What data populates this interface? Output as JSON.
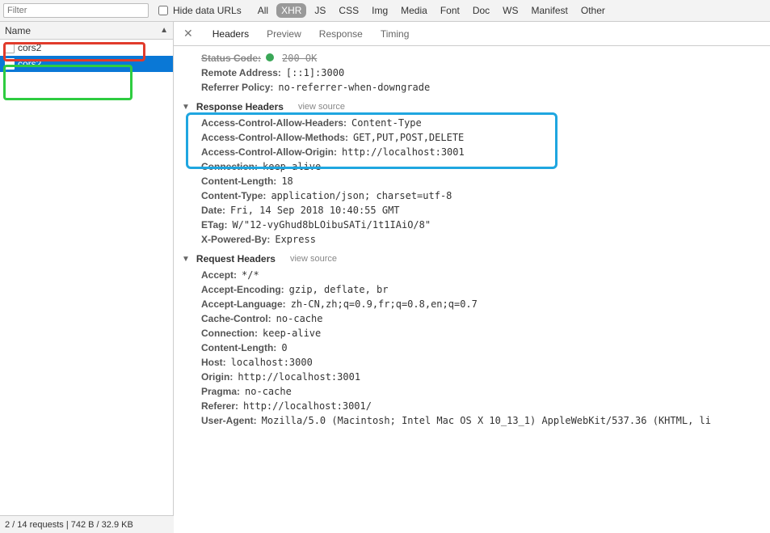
{
  "toolbar": {
    "filter_placeholder": "Filter",
    "hide_data_urls": "Hide data URLs",
    "types": [
      "All",
      "XHR",
      "JS",
      "CSS",
      "Img",
      "Media",
      "Font",
      "Doc",
      "WS",
      "Manifest",
      "Other"
    ],
    "active_type": "XHR"
  },
  "left": {
    "header": "Name",
    "items": [
      "cors2",
      "cors2"
    ],
    "selected_index": 1
  },
  "detail_tabs": {
    "items": [
      "Headers",
      "Preview",
      "Response",
      "Timing"
    ],
    "active": "Headers"
  },
  "general": {
    "status_code_label": "Status Code:",
    "status_code_value": "200 OK",
    "remote_address_label": "Remote Address:",
    "remote_address_value": "[::1]:3000",
    "referrer_policy_label": "Referrer Policy:",
    "referrer_policy_value": "no-referrer-when-downgrade"
  },
  "response_headers": {
    "title": "Response Headers",
    "view_source": "view source",
    "rows": [
      {
        "k": "Access-Control-Allow-Headers:",
        "v": "Content-Type"
      },
      {
        "k": "Access-Control-Allow-Methods:",
        "v": "GET,PUT,POST,DELETE"
      },
      {
        "k": "Access-Control-Allow-Origin:",
        "v": "http://localhost:3001"
      },
      {
        "k": "Connection:",
        "v": "keep-alive"
      },
      {
        "k": "Content-Length:",
        "v": "18"
      },
      {
        "k": "Content-Type:",
        "v": "application/json; charset=utf-8"
      },
      {
        "k": "Date:",
        "v": "Fri, 14 Sep 2018 10:40:55 GMT"
      },
      {
        "k": "ETag:",
        "v": "W/\"12-vyGhud8bLOibuSATi/1t1IAiO/8\""
      },
      {
        "k": "X-Powered-By:",
        "v": "Express"
      }
    ]
  },
  "request_headers": {
    "title": "Request Headers",
    "view_source": "view source",
    "rows": [
      {
        "k": "Accept:",
        "v": "*/*"
      },
      {
        "k": "Accept-Encoding:",
        "v": "gzip, deflate, br"
      },
      {
        "k": "Accept-Language:",
        "v": "zh-CN,zh;q=0.9,fr;q=0.8,en;q=0.7"
      },
      {
        "k": "Cache-Control:",
        "v": "no-cache"
      },
      {
        "k": "Connection:",
        "v": "keep-alive"
      },
      {
        "k": "Content-Length:",
        "v": "0"
      },
      {
        "k": "Host:",
        "v": "localhost:3000"
      },
      {
        "k": "Origin:",
        "v": "http://localhost:3001"
      },
      {
        "k": "Pragma:",
        "v": "no-cache"
      },
      {
        "k": "Referer:",
        "v": "http://localhost:3001/"
      },
      {
        "k": "User-Agent:",
        "v": "Mozilla/5.0 (Macintosh; Intel Mac OS X 10_13_1) AppleWebKit/537.36 (KHTML, li"
      }
    ]
  },
  "status_bar": "2 / 14 requests | 742 B / 32.9 KB"
}
